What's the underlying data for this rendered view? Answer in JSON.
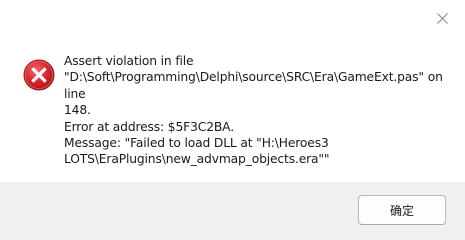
{
  "dialog": {
    "message": "Assert violation in file\n\"D:\\Soft\\Programming\\Delphi\\source\\SRC\\Era\\GameExt.pas\" on line\n148.\nError at address: $5F3C2BA.\nMessage: \"Failed to load DLL at \"H:\\Heroes3\nLOTS\\EraPlugins\\new_advmap_objects.era\"\"",
    "ok_label": "确定",
    "icon": "error-icon",
    "close_icon": "close-icon"
  },
  "colors": {
    "error_red": "#d7262b",
    "footer_bg": "#f0f0f0"
  }
}
